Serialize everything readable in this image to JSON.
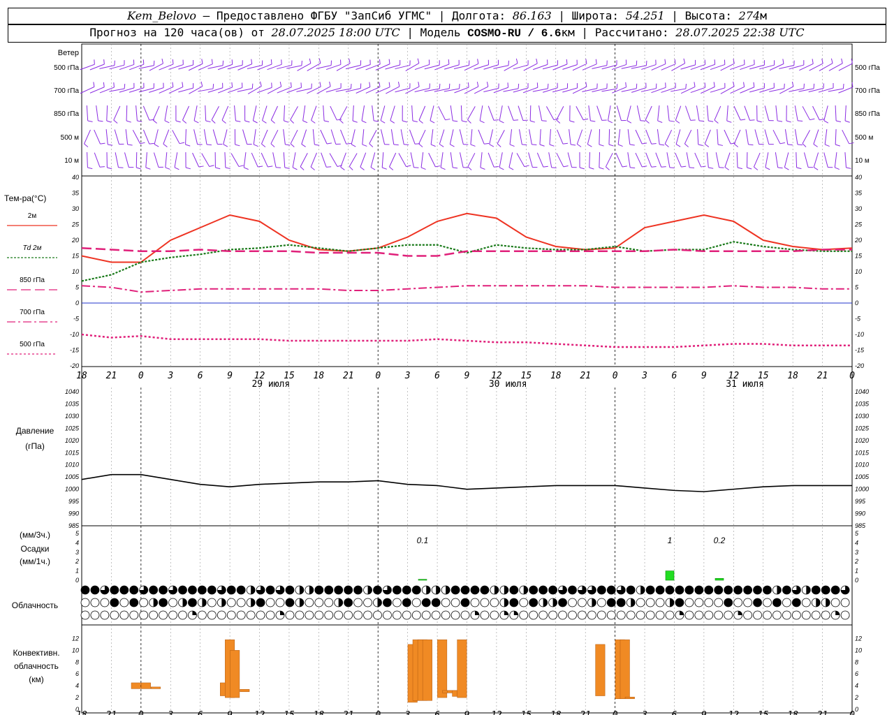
{
  "header": {
    "station": "Kem_Belovo",
    "provider": " – Предоставлено ФГБУ \"ЗапСиб УГМС\" | Долгота: ",
    "longitude": "86.163",
    "lat_label": " | Широта: ",
    "latitude": "54.251",
    "alt_label": " | Высота: ",
    "altitude": "274",
    "alt_unit": "м",
    "forecast_label": "Прогноз на 120 часа(ов) от ",
    "forecast_start": "28.07.2025 18:00 UTC",
    "model_label": " | Модель ",
    "model": "COSMO-RU / 6.6",
    "model_unit": "км",
    "calc_label": " | Рассчитано: ",
    "calculated": "28.07.2025 22:38 UTC"
  },
  "time_axis": {
    "tick_labels": [
      "18",
      "21",
      "0",
      "3",
      "6",
      "9",
      "12",
      "15",
      "18",
      "21",
      "0",
      "3",
      "6",
      "9",
      "12",
      "15",
      "18",
      "21",
      "0",
      "3",
      "6",
      "9",
      "12",
      "15",
      "18",
      "21",
      "0"
    ],
    "day_labels": [
      "29 июля",
      "30 июля",
      "31 июля"
    ]
  },
  "wind_panel": {
    "title": "Ветер",
    "levels": [
      "500 гПа",
      "700 гПа",
      "850 гПа",
      "500 м",
      "10  м"
    ]
  },
  "temperature_panel": {
    "title": "Тем-ра(°C)",
    "legend": [
      "2м",
      "Td  2м",
      "850 гПа",
      "700 гПа",
      "500 гПа"
    ],
    "ticks": [
      "40",
      "35",
      "30",
      "25",
      "20",
      "15",
      "10",
      "5",
      "0",
      "-5",
      "-10",
      "-15",
      "-20"
    ]
  },
  "pressure_panel": {
    "title": "Давление",
    "unit": "(гПа)",
    "ticks": [
      "1040",
      "1035",
      "1030",
      "1025",
      "1020",
      "1015",
      "1010",
      "1005",
      "1000",
      "995",
      "990",
      "985"
    ]
  },
  "precip_panel": {
    "title_3h": "(мм/3ч.)",
    "title": "Осадки",
    "title_1h": "(мм/1ч.)",
    "ticks": [
      "5",
      "4",
      "3",
      "2",
      "1",
      "0"
    ],
    "annotations": [
      "0.1",
      "1",
      "0.2"
    ]
  },
  "cloud_panel": {
    "title": "Облачность"
  },
  "convective_panel": {
    "title": [
      "Конвективн.",
      "облачность",
      "(км)"
    ],
    "ticks": [
      "12",
      "10",
      "8",
      "6",
      "4",
      "2",
      "0"
    ]
  },
  "colors": {
    "t2m": "#ee3322",
    "td2m": "#1a7a1a",
    "t_levels": "#e0207a",
    "wind_barbs": "#8a2be2",
    "precip": "#22dd22",
    "convective": "#f08a24",
    "zero_line": "#2233cc"
  },
  "chart_data": [
    {
      "type": "line",
      "title": "Тем-ра(°C)",
      "x": [
        "18",
        "21",
        "0",
        "3",
        "6",
        "9",
        "12",
        "15",
        "18",
        "21",
        "0",
        "3",
        "6",
        "9",
        "12",
        "15",
        "18",
        "21",
        "0",
        "3",
        "6",
        "9",
        "12",
        "15",
        "18",
        "21",
        "0"
      ],
      "ylim": [
        -20,
        40
      ],
      "series": [
        {
          "name": "2м",
          "values": [
            15,
            13,
            13,
            20,
            24,
            28,
            26,
            20,
            17,
            16.5,
            17.5,
            21,
            26,
            28.5,
            27,
            21,
            18,
            17,
            17.5,
            24,
            26,
            28,
            26,
            20,
            18,
            17,
            17.5
          ]
        },
        {
          "name": "Td  2м",
          "values": [
            7,
            9,
            13,
            14.5,
            15.5,
            17,
            17.5,
            18.5,
            17.5,
            16.5,
            17.5,
            18.5,
            18.5,
            16,
            18.5,
            17.5,
            17,
            17,
            18,
            16.5,
            17,
            17,
            19.5,
            18,
            17,
            16.5,
            16.5
          ]
        },
        {
          "name": "850 гПа",
          "values": [
            17.5,
            17,
            16.5,
            16.5,
            17,
            16.5,
            16.5,
            16.5,
            16,
            16,
            16,
            15,
            15,
            16.5,
            16.5,
            16.5,
            16.5,
            16.5,
            16.5,
            16.5,
            17,
            16.5,
            16.5,
            16.5,
            16.5,
            17,
            17
          ]
        },
        {
          "name": "700 гПа",
          "values": [
            5.5,
            5,
            3.5,
            4,
            4.5,
            4.5,
            4.5,
            4.5,
            4.5,
            4,
            4,
            4.5,
            5,
            5.5,
            5.5,
            5.5,
            5.5,
            5.5,
            5,
            5,
            5,
            5,
            5.5,
            5,
            5,
            4.5,
            4.5
          ]
        },
        {
          "name": "500 гПа",
          "values": [
            -10,
            -11,
            -10.5,
            -11.5,
            -11.5,
            -11.5,
            -11.5,
            -12,
            -12,
            -12,
            -12,
            -12,
            -11.5,
            -12,
            -12.5,
            -12.5,
            -13,
            -13.5,
            -14,
            -14,
            -14,
            -13.5,
            -13,
            -13,
            -13.5,
            -13.5,
            -13.5
          ]
        }
      ]
    },
    {
      "type": "line",
      "title": "Давление",
      "x": [
        "18",
        "21",
        "0",
        "3",
        "6",
        "9",
        "12",
        "15",
        "18",
        "21",
        "0",
        "3",
        "6",
        "9",
        "12",
        "15",
        "18",
        "21",
        "0",
        "3",
        "6",
        "9",
        "12",
        "15",
        "18",
        "21",
        "0"
      ],
      "ylim": [
        985,
        1040
      ],
      "series": [
        {
          "values": [
            1004,
            1006,
            1006,
            1004,
            1002,
            1001,
            1002,
            1002.5,
            1003,
            1003,
            1003.5,
            1002,
            1001.5,
            1000,
            1000.5,
            1001,
            1001.5,
            1001.5,
            1001.5,
            1000.5,
            999.5,
            999,
            1000,
            1001,
            1001.5,
            1001.5,
            1001.5
          ]
        }
      ]
    },
    {
      "type": "bar",
      "title": "Осадки",
      "x": [
        "3",
        "6",
        "9"
      ],
      "ylim": [
        0,
        5
      ],
      "series": [
        {
          "name": "(мм/3ч.)",
          "values": [
            0.1,
            1,
            0.2
          ]
        }
      ]
    },
    {
      "type": "bar",
      "title": "Конвективн. облачность (км)",
      "ylim": [
        0,
        12
      ],
      "x": [
        0,
        1,
        2,
        9,
        9.5,
        10,
        11,
        28,
        28.5,
        29,
        29.5,
        31,
        31.5,
        32,
        32.5,
        33,
        47,
        49,
        49.5,
        50
      ],
      "base": [
        3.5,
        3.5,
        3.5,
        2.3,
        2,
        2,
        3,
        1.2,
        1.5,
        1.5,
        1.5,
        2,
        2.8,
        2.8,
        2.2,
        2,
        2.3,
        1.8,
        1.8,
        1.8
      ],
      "series": [
        {
          "name": "top",
          "values": [
            4.5,
            4.5,
            3.8,
            4.5,
            11.8,
            10,
            3.4,
            11,
            11.8,
            11.8,
            11.8,
            11.8,
            3.2,
            3.2,
            3.2,
            11.8,
            11,
            11.8,
            11.8,
            2.1
          ]
        }
      ]
    }
  ]
}
